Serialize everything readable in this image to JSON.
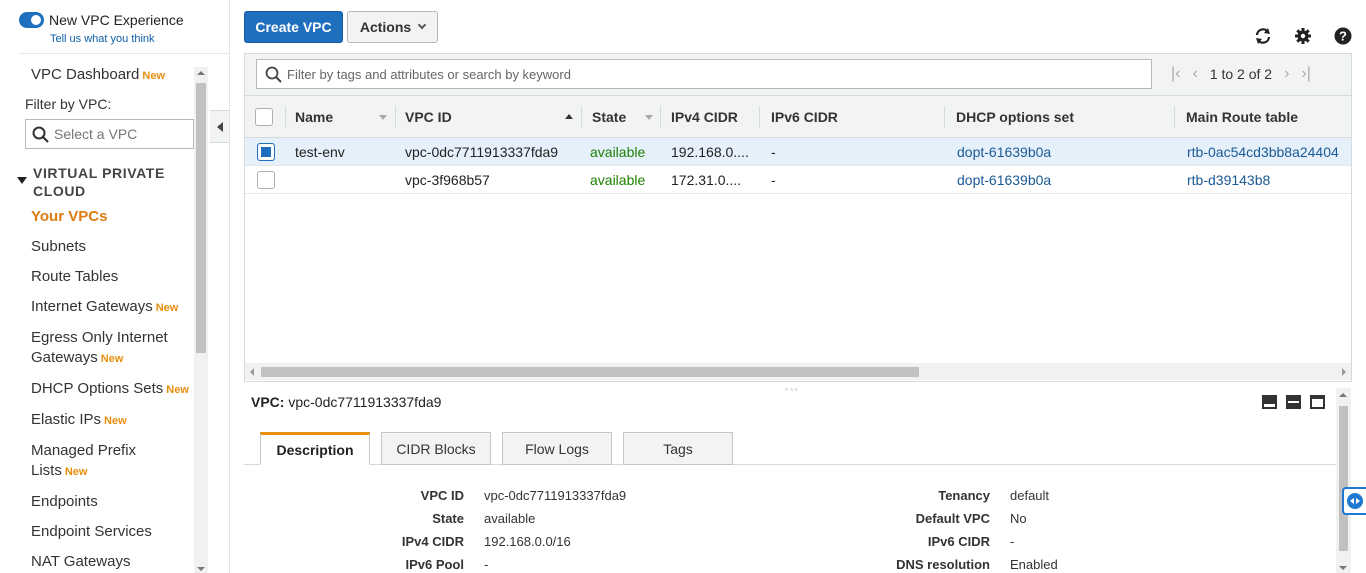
{
  "sidebar": {
    "toggle_label": "New VPC Experience",
    "toggle_sub": "Tell us what you think",
    "dashboard_label": "VPC Dashboard",
    "new_badge": "New",
    "filter_label": "Filter by VPC:",
    "filter_placeholder": "Select a VPC",
    "section_title": "VIRTUAL PRIVATE CLOUD",
    "items": [
      {
        "label": "Your VPCs",
        "badge": "",
        "active": true
      },
      {
        "label": "Subnets",
        "badge": ""
      },
      {
        "label": "Route Tables",
        "badge": ""
      },
      {
        "label": "Internet Gateways",
        "badge": "New"
      },
      {
        "label": "Egress Only Internet",
        "label2": "Gateways",
        "badge": "New"
      },
      {
        "label": "DHCP Options Sets",
        "badge": "New"
      },
      {
        "label": "Elastic IPs",
        "badge": "New"
      },
      {
        "label": "Managed Prefix",
        "label2": "Lists",
        "badge": "New"
      },
      {
        "label": "Endpoints",
        "badge": ""
      },
      {
        "label": "Endpoint Services",
        "badge": ""
      },
      {
        "label": "NAT Gateways",
        "badge": ""
      }
    ]
  },
  "toolbar": {
    "create_label": "Create VPC",
    "actions_label": "Actions",
    "icons": [
      "refresh-icon",
      "gear-icon",
      "help-icon"
    ]
  },
  "grid": {
    "search_placeholder": "Filter by tags and attributes or search by keyword",
    "pager_text": "1 to 2 of 2",
    "columns": [
      "Name",
      "VPC ID",
      "State",
      "IPv4 CIDR",
      "IPv6 CIDR",
      "DHCP options set",
      "Main Route table"
    ],
    "rows": [
      {
        "selected": true,
        "name": "test-env",
        "vpc_id": "vpc-0dc7711913337fda9",
        "state": "available",
        "ipv4": "192.168.0....",
        "ipv6": "-",
        "dhcp": "dopt-61639b0a",
        "route": "rtb-0ac54cd3bb8a24404"
      },
      {
        "selected": false,
        "name": "",
        "vpc_id": "vpc-3f968b57",
        "state": "available",
        "ipv4": "172.31.0....",
        "ipv6": "-",
        "dhcp": "dopt-61639b0a",
        "route": "rtb-d39143b8"
      }
    ]
  },
  "detail": {
    "title_prefix": "VPC:",
    "title_value": "vpc-0dc7711913337fda9",
    "tabs": [
      "Description",
      "CIDR Blocks",
      "Flow Logs",
      "Tags"
    ],
    "left": [
      {
        "label": "VPC ID",
        "value": "vpc-0dc7711913337fda9",
        "status": false
      },
      {
        "label": "State",
        "value": "available",
        "status": true
      },
      {
        "label": "IPv4 CIDR",
        "value": "192.168.0.0/16",
        "status": false
      },
      {
        "label": "IPv6 Pool",
        "value": "-",
        "status": false
      }
    ],
    "right": [
      {
        "label": "Tenancy",
        "value": "default"
      },
      {
        "label": "Default VPC",
        "value": "No"
      },
      {
        "label": "IPv6 CIDR",
        "value": "-"
      },
      {
        "label": "DNS resolution",
        "value": "Enabled"
      }
    ]
  },
  "colors": {
    "primary": "#1f6fbf",
    "active_nav": "#e07b12",
    "new_badge": "#e88e0f",
    "status_green": "#1d8102",
    "link": "#1a5a96"
  }
}
